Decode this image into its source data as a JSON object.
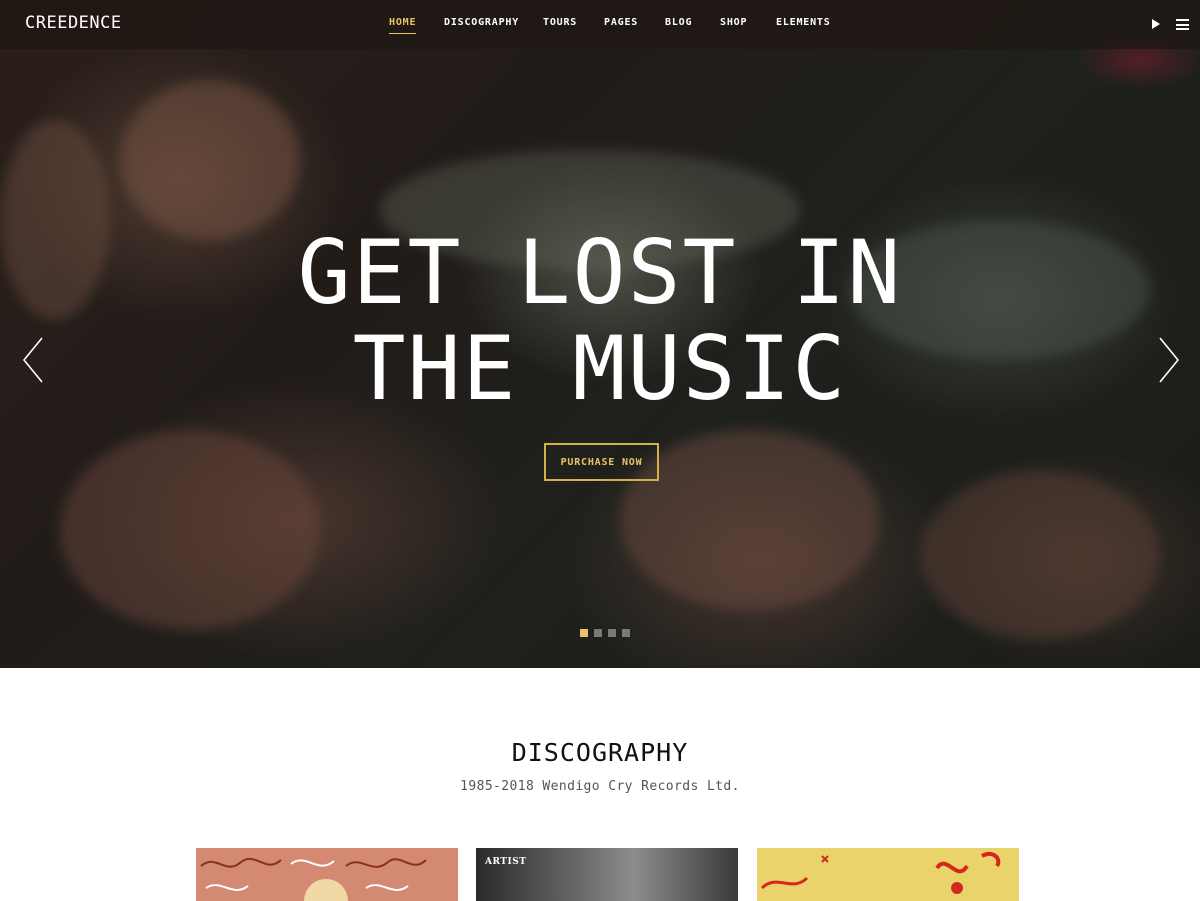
{
  "header": {
    "logo": "CREEDENCE",
    "nav": [
      "HOME",
      "DISCOGRAPHY",
      "TOURS",
      "PAGES",
      "BLOG",
      "SHOP",
      "ELEMENTS"
    ],
    "active_index": 0
  },
  "hero": {
    "headline_line1": "GET LOST IN",
    "headline_line2": "THE MUSIC",
    "cta_label": "PURCHASE NOW",
    "slides_total": 4,
    "slide_active": 1
  },
  "discography": {
    "title": "DISCOGRAPHY",
    "subtitle": "1985-2018 Wendigo Cry Records Ltd.",
    "albums": [
      {
        "label": ""
      },
      {
        "label": "ARTIST"
      },
      {
        "label": ""
      }
    ]
  },
  "colors": {
    "accent": "#e9c46a",
    "nav_bg": "#1e1612",
    "text_dark": "#111111"
  },
  "icons": {
    "play": "play-icon",
    "menu": "hamburger-menu-icon",
    "prev": "chevron-left-icon",
    "next": "chevron-right-icon"
  }
}
